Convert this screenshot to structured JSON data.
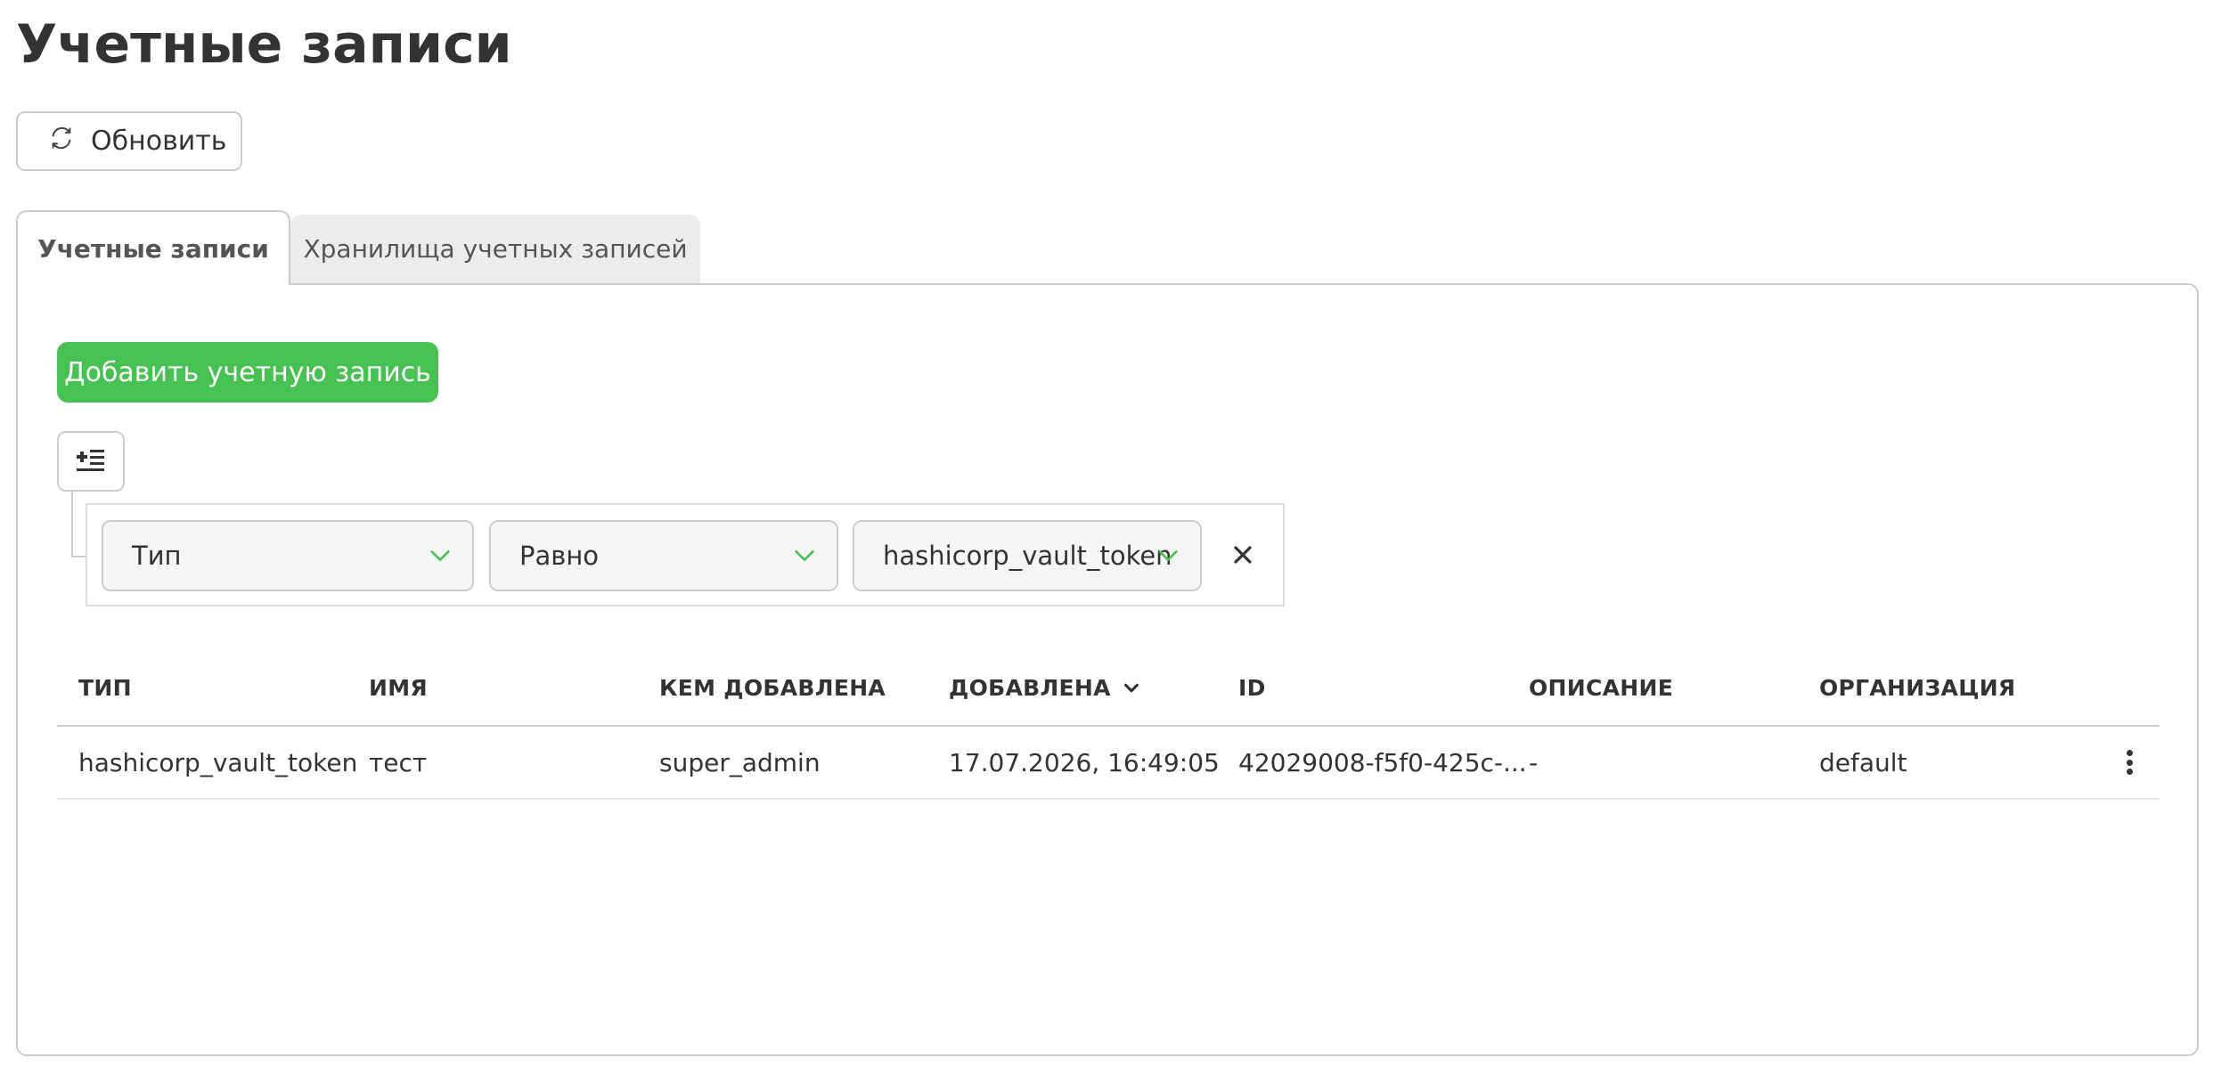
{
  "header": {
    "title": "Учетные записи"
  },
  "toolbar": {
    "refresh_label": "Обновить"
  },
  "tabs": [
    {
      "label": "Учетные записи",
      "active": true
    },
    {
      "label": "Хранилища учетных записей",
      "active": false
    }
  ],
  "actions": {
    "add_label": "Добавить учетную запись"
  },
  "filter": {
    "field": "Тип",
    "operator": "Равно",
    "value": "hashicorp_vault_token"
  },
  "table": {
    "columns": [
      "ТИП",
      "ИМЯ",
      "КЕМ ДОБАВЛЕНА",
      "ДОБАВЛЕНА",
      "ID",
      "ОПИСАНИЕ",
      "ОРГАНИЗАЦИЯ"
    ],
    "sorted_column": "ДОБАВЛЕНА",
    "rows": [
      {
        "type": "hashicorp_vault_token",
        "name": "тест",
        "added_by": "super_admin",
        "added_at": "17.07.2026, 16:49:05",
        "id": "42029008-f5f0-425c-...",
        "description": "-",
        "organization": "default"
      }
    ]
  },
  "colors": {
    "accent": "#46c253",
    "border": "#cccccc",
    "text": "#333333"
  },
  "icons": [
    "refresh-icon",
    "filter-add-icon",
    "chevron-down-icon",
    "close-icon",
    "sort-desc-icon",
    "kebab-menu-icon"
  ]
}
